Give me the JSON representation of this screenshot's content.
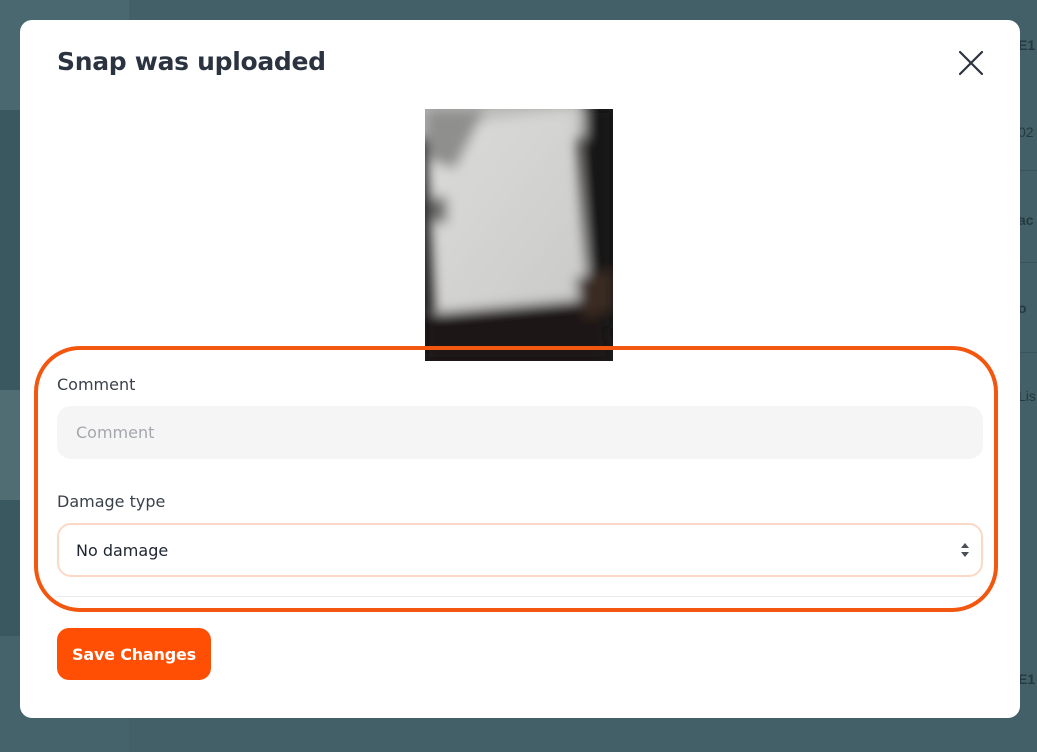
{
  "background": {
    "fragments": [
      "E1",
      "02",
      "ac",
      "o",
      "Lis",
      "E1"
    ]
  },
  "modal": {
    "title": "Snap was uploaded",
    "close_icon": "close-icon",
    "comment": {
      "label": "Comment",
      "value": "",
      "placeholder": "Comment"
    },
    "damage_type": {
      "label": "Damage type",
      "selected": "No damage"
    },
    "save_label": "Save Changes"
  },
  "colors": {
    "accent": "#ff4f04",
    "highlight": "#f2560f",
    "title": "#2b3340",
    "input_bg": "#f5f5f6",
    "select_border": "#fbd9c6"
  }
}
